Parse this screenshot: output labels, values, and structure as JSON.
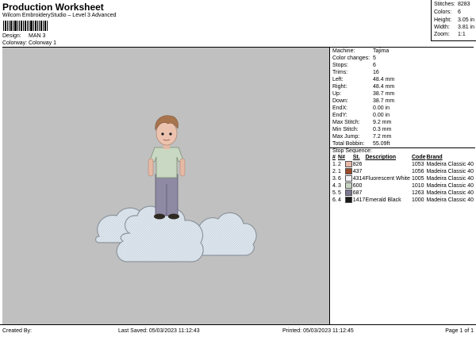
{
  "header": {
    "title": "Production Worksheet",
    "subtitle": "Wilcom EmbroideryStudio – Level 3 Advanced",
    "design_label": "Design:",
    "design_value": "MAN 3",
    "colorway_label": "Colorway:",
    "colorway_value": "Colorway 1"
  },
  "stats": [
    {
      "label": "Stitches:",
      "value": "8283"
    },
    {
      "label": "Colors:",
      "value": "6"
    },
    {
      "label": "Height:",
      "value": "3.05 in"
    },
    {
      "label": "Width:",
      "value": "3.81 in"
    },
    {
      "label": "Zoom:",
      "value": "1:1"
    }
  ],
  "machine": [
    {
      "label": "Machine:",
      "value": "Tajima"
    },
    {
      "label": "Color changes:",
      "value": "5"
    },
    {
      "label": "Stops:",
      "value": "6"
    },
    {
      "label": "Trims:",
      "value": "16"
    },
    {
      "label": "Left:",
      "value": "48.4 mm"
    },
    {
      "label": "Right:",
      "value": "48.4 mm"
    },
    {
      "label": "Up:",
      "value": "38.7 mm"
    },
    {
      "label": "Down:",
      "value": "38.7 mm"
    },
    {
      "label": "EndX:",
      "value": "0.00 in"
    },
    {
      "label": "EndY:",
      "value": "0.00 in"
    },
    {
      "label": "Max Stitch:",
      "value": "9.2 mm"
    },
    {
      "label": "Min Stitch:",
      "value": "0.3 mm"
    },
    {
      "label": "Max Jump:",
      "value": "7.2 mm"
    },
    {
      "label": "Total Bobbin:",
      "value": "55.09ft"
    }
  ],
  "stop_sequence": {
    "title": "Stop Sequence:",
    "headers": {
      "num": "#",
      "n": "N#",
      "st": "St.",
      "desc": "Description",
      "code": "Code",
      "brand": "Brand"
    },
    "rows": [
      {
        "num": "1.",
        "n": "2",
        "color": "#e8b8a8",
        "st": "826",
        "desc": "",
        "code": "1053",
        "brand": "Madeira Classic 40"
      },
      {
        "num": "2.",
        "n": "1",
        "color": "#9a4a2a",
        "st": "437",
        "desc": "",
        "code": "1056",
        "brand": "Madeira Classic 40"
      },
      {
        "num": "3.",
        "n": "6",
        "color": "#f4f4f8",
        "st": "4314",
        "desc": "Fluorescent White",
        "code": "1005",
        "brand": "Madeira Classic 40"
      },
      {
        "num": "4.",
        "n": "3",
        "color": "#c8d4c4",
        "st": "600",
        "desc": "",
        "code": "1010",
        "brand": "Madeira Classic 40"
      },
      {
        "num": "5.",
        "n": "5",
        "color": "#7a7890",
        "st": "687",
        "desc": "",
        "code": "1263",
        "brand": "Madeira Classic 40"
      },
      {
        "num": "6.",
        "n": "4",
        "color": "#1a1a1a",
        "st": "1417",
        "desc": "Emerald Black",
        "code": "1000",
        "brand": "Madeira Classic 40"
      }
    ]
  },
  "footer": {
    "created_by": "Created By:",
    "last_saved": "Last Saved: 05/03/2023 11:12:43",
    "printed": "Printed: 05/03/2023 11:12:45",
    "page": "Page 1 of 1"
  }
}
